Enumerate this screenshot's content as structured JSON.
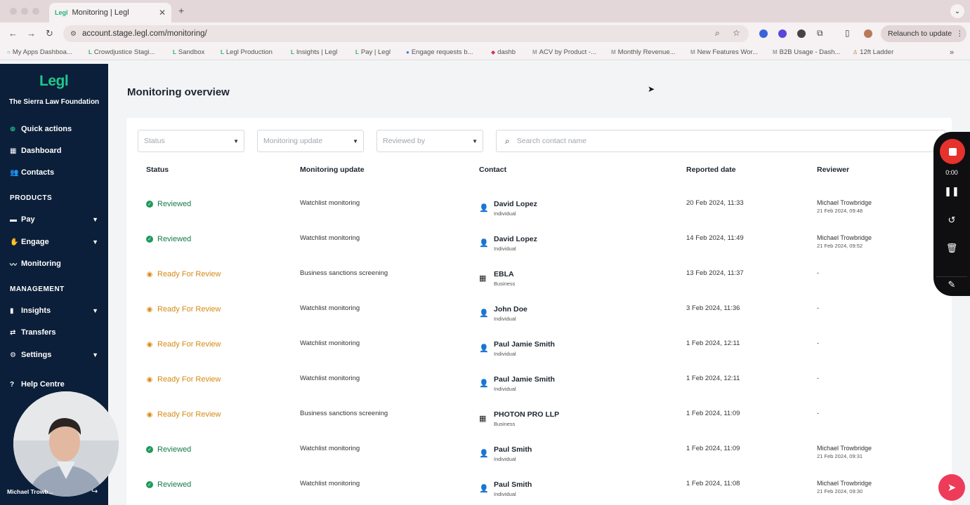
{
  "browser": {
    "tab_title": "Monitoring | Legl",
    "tab_favicon": "Legl",
    "url": "account.stage.legl.com/monitoring/",
    "relaunch_label": "Relaunch to update",
    "bookmarks": [
      "My Apps Dashboa...",
      "Crowdjustice Stagi...",
      "Sandbox",
      "Legl Production",
      "Insights | Legl",
      "Pay | Legl",
      "Engage requests b...",
      "dashb",
      "ACV by Product -...",
      "Monthly Revenue...",
      "New Features Wor...",
      "B2B Usage - Dash...",
      "12ft Ladder"
    ]
  },
  "sidebar": {
    "logo": "Legl",
    "org_name": "The Sierra Law Foundation",
    "items": [
      {
        "label": "Quick actions"
      },
      {
        "label": "Dashboard"
      },
      {
        "label": "Contacts"
      }
    ],
    "products_heading": "PRODUCTS",
    "products": [
      {
        "label": "Pay"
      },
      {
        "label": "Engage"
      },
      {
        "label": "Monitoring"
      }
    ],
    "management_heading": "MANAGEMENT",
    "management": [
      {
        "label": "Insights"
      },
      {
        "label": "Transfers"
      },
      {
        "label": "Settings"
      }
    ],
    "help": "Help Centre",
    "user_name": "Michael Trowb..."
  },
  "main": {
    "title": "Monitoring overview",
    "filters": {
      "status_placeholder": "Status",
      "update_placeholder": "Monitoring update",
      "reviewer_placeholder": "Reviewed by",
      "search_placeholder": "Search contact name"
    },
    "columns": {
      "status": "Status",
      "update": "Monitoring update",
      "contact": "Contact",
      "date": "Reported date",
      "reviewer": "Reviewer"
    },
    "rows": [
      {
        "status": "Reviewed",
        "update": "Watchlist monitoring",
        "name": "David Lopez",
        "type": "Individual",
        "date": "20 Feb 2024, 11:33",
        "reviewer": "Michael Trowbridge",
        "reviewed_on": "21 Feb 2024, 09:48"
      },
      {
        "status": "Reviewed",
        "update": "Watchlist monitoring",
        "name": "David Lopez",
        "type": "Individual",
        "date": "14 Feb 2024, 11:49",
        "reviewer": "Michael Trowbridge",
        "reviewed_on": "21 Feb 2024, 09:52"
      },
      {
        "status": "Ready For Review",
        "update": "Business sanctions screening",
        "name": "EBLA",
        "type": "Business",
        "date": "13 Feb 2024, 11:37",
        "reviewer": "-",
        "reviewed_on": ""
      },
      {
        "status": "Ready For Review",
        "update": "Watchlist monitoring",
        "name": "John Doe",
        "type": "Individual",
        "date": "3 Feb 2024, 11:36",
        "reviewer": "-",
        "reviewed_on": ""
      },
      {
        "status": "Ready For Review",
        "update": "Watchlist monitoring",
        "name": "Paul Jamie Smith",
        "type": "Individual",
        "date": "1 Feb 2024, 12:11",
        "reviewer": "-",
        "reviewed_on": ""
      },
      {
        "status": "Ready For Review",
        "update": "Watchlist monitoring",
        "name": "Paul Jamie Smith",
        "type": "Individual",
        "date": "1 Feb 2024, 12:11",
        "reviewer": "-",
        "reviewed_on": ""
      },
      {
        "status": "Ready For Review",
        "update": "Business sanctions screening",
        "name": "PHOTON PRO LLP",
        "type": "Business",
        "date": "1 Feb 2024, 11:09",
        "reviewer": "-",
        "reviewed_on": ""
      },
      {
        "status": "Reviewed",
        "update": "Watchlist monitoring",
        "name": "Paul Smith",
        "type": "Individual",
        "date": "1 Feb 2024, 11:09",
        "reviewer": "Michael Trowbridge",
        "reviewed_on": "21 Feb 2024, 09:31"
      },
      {
        "status": "Reviewed",
        "update": "Watchlist monitoring",
        "name": "Paul Smith",
        "type": "Individual",
        "date": "1 Feb 2024, 11:08",
        "reviewer": "Michael Trowbridge",
        "reviewed_on": "21 Feb 2024, 09:30"
      }
    ]
  },
  "recorder": {
    "time": "0:00"
  },
  "colors": {
    "sidebar_bg": "#0c1f3a",
    "brand_green": "#1ec98a",
    "reviewed_green": "#167a4a",
    "ready_orange": "#d68a13",
    "record_red": "#e5322d",
    "fab_pink": "#ee3b5a"
  },
  "icons": {
    "quick_actions": "plus-circle-icon",
    "dashboard": "grid-icon",
    "contacts": "users-icon",
    "pay": "card-icon",
    "engage": "handshake-icon",
    "monitoring": "pulse-icon",
    "insights": "bar-chart-icon",
    "transfers": "arrows-icon",
    "settings": "gear-icon",
    "help": "help-icon",
    "individual": "person-icon",
    "business": "building-icon"
  }
}
